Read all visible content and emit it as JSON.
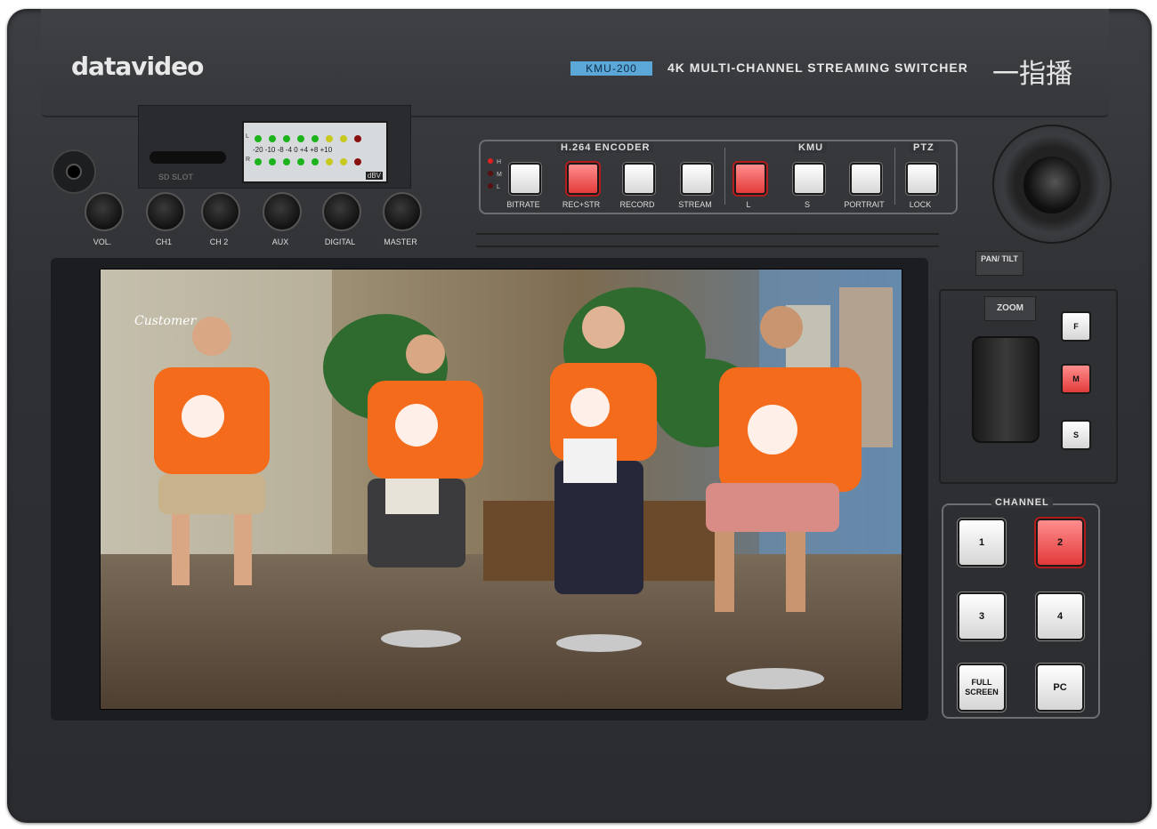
{
  "brand": {
    "logo": "datavideo",
    "model": "KMU-200",
    "subtitle": "4K MULTI-CHANNEL STREAMING SWITCHER",
    "chinese_name": "一指播"
  },
  "sd": {
    "label": "SD SLOT"
  },
  "meter": {
    "scale": "-20 -10 -8 -4  0 +4 +8 +10",
    "unit": "dBV",
    "row_l": "L",
    "row_r": "R"
  },
  "knobs": [
    "VOL.",
    "CH1",
    "CH 2",
    "AUX",
    "DIGITAL",
    "MASTER"
  ],
  "encoder": {
    "group_h264": "H.264 ENCODER",
    "group_kmu": "KMU",
    "group_ptz": "PTZ",
    "hml": [
      "H",
      "M",
      "L"
    ],
    "buttons": [
      "BITRATE",
      "REC+STR",
      "RECORD",
      "STREAM",
      "L",
      "S",
      "PORTRAIT",
      "LOCK"
    ]
  },
  "ptz": {
    "pan_tilt": "PAN/ TILT",
    "zoom": "ZOOM",
    "speed": [
      "F",
      "M",
      "S"
    ]
  },
  "channel": {
    "title": "CHANNEL",
    "buttons": [
      "1",
      "2",
      "3",
      "4",
      "FULL SCREEN",
      "PC"
    ]
  },
  "scene_text": {
    "sign": "Customer"
  }
}
